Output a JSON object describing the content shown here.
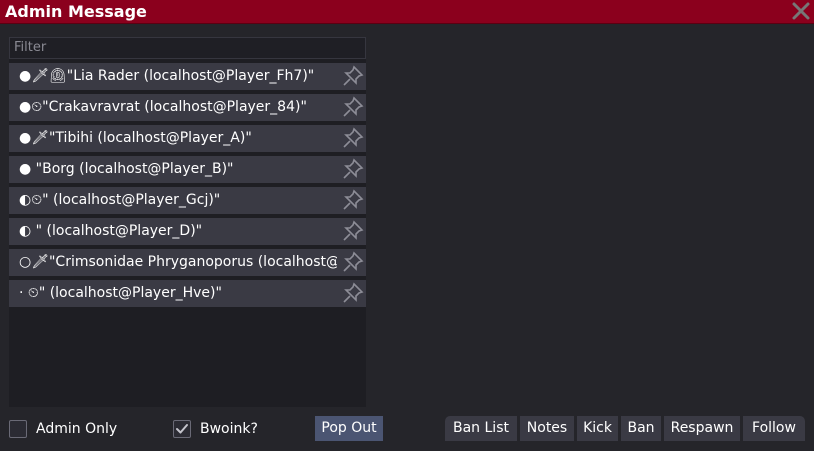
{
  "window": {
    "title": "Admin Message"
  },
  "filter": {
    "placeholder": "Filter"
  },
  "players": [
    {
      "text": "●🗡⏲\"Lia Rader (localhost@Player_Fh7)\""
    },
    {
      "text": "●⏲\"Crakavravrat (localhost@Player_84)\""
    },
    {
      "text": "●🗡\"Tibihi (localhost@Player_A)\""
    },
    {
      "text": "● \"Borg (localhost@Player_B)\""
    },
    {
      "text": "◐⏲\" (localhost@Player_Gcj)\""
    },
    {
      "text": "◐ \" (localhost@Player_D)\""
    },
    {
      "text": "○🗡\"Crimsonidae Phryganoporus (localhost@Player_C)\""
    },
    {
      "text": "· ⏲\" (localhost@Player_Hve)\""
    }
  ],
  "options": {
    "admin_only": "Admin Only",
    "bwoink": "Bwoink?"
  },
  "buttons": {
    "pop_out": "Pop Out",
    "ban_list": "Ban List",
    "notes": "Notes",
    "kick": "Kick",
    "ban": "Ban",
    "respawn": "Respawn",
    "follow": "Follow"
  },
  "icons": {
    "close": "close-icon",
    "pin": "pin-icon"
  },
  "colors": {
    "titlebar": "#8b001d",
    "panel": "#1e1e23",
    "row": "#3a3a44",
    "pop_out": "#4b5572"
  }
}
